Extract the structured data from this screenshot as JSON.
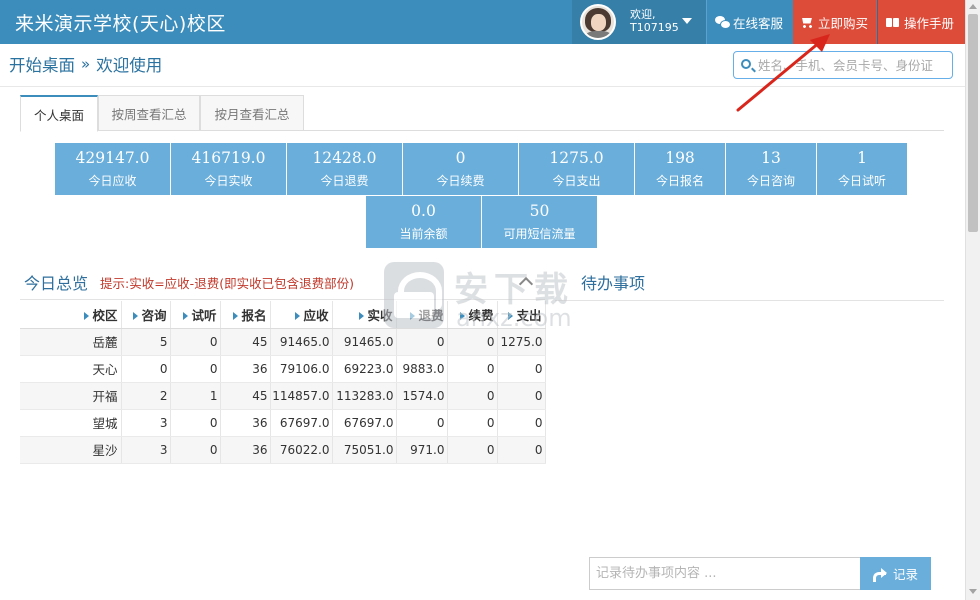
{
  "app": {
    "title": "来米演示学校(天心)校区"
  },
  "user": {
    "welcome": "欢迎,",
    "id": "T107195"
  },
  "header_buttons": {
    "service": "在线客服",
    "buy": "立即购买",
    "manual": "操作手册"
  },
  "breadcrumb": {
    "home": "开始桌面",
    "separator": "»",
    "current": "欢迎使用"
  },
  "search": {
    "placeholder": "姓名、手机、会员卡号、身份证"
  },
  "tabs": [
    {
      "label": "个人桌面",
      "active": true
    },
    {
      "label": "按周查看汇总",
      "active": false
    },
    {
      "label": "按月查看汇总",
      "active": false
    }
  ],
  "stats_row1": [
    {
      "value": "429147.0",
      "label": "今日应收"
    },
    {
      "value": "416719.0",
      "label": "今日实收"
    },
    {
      "value": "12428.0",
      "label": "今日退费"
    },
    {
      "value": "0",
      "label": "今日续费"
    },
    {
      "value": "1275.0",
      "label": "今日支出"
    },
    {
      "value": "198",
      "label": "今日报名"
    },
    {
      "value": "13",
      "label": "今日咨询"
    },
    {
      "value": "1",
      "label": "今日试听"
    }
  ],
  "stats_row2": [
    {
      "value": "0.0",
      "label": "当前余额"
    },
    {
      "value": "50",
      "label": "可用短信流量"
    }
  ],
  "summary": {
    "title": "今日总览",
    "hint": "提示:实收=应收-退费(即实收已包含退费部份)",
    "columns": [
      "校区",
      "咨询",
      "试听",
      "报名",
      "应收",
      "实收",
      "退费",
      "续费",
      "支出"
    ],
    "rows": [
      [
        "岳麓",
        "5",
        "0",
        "45",
        "91465.0",
        "91465.0",
        "0",
        "0",
        "1275.0"
      ],
      [
        "天心",
        "0",
        "0",
        "36",
        "79106.0",
        "69223.0",
        "9883.0",
        "0",
        "0"
      ],
      [
        "开福",
        "2",
        "1",
        "45",
        "114857.0",
        "113283.0",
        "1574.0",
        "0",
        "0"
      ],
      [
        "望城",
        "3",
        "0",
        "36",
        "67697.0",
        "67697.0",
        "0",
        "0",
        "0"
      ],
      [
        "星沙",
        "3",
        "0",
        "36",
        "76022.0",
        "75051.0",
        "971.0",
        "0",
        "0"
      ]
    ]
  },
  "todo": {
    "title": "待办事项",
    "placeholder": "记录待办事项内容 ...",
    "button": "记录"
  },
  "watermark": {
    "cn": "安下载",
    "en": "anxz.com"
  },
  "colors": {
    "topbar": "#3c8dbc",
    "user_box": "#367fa9",
    "buy": "#dd4b39",
    "tile": "#6aaedb",
    "hint": "#c0392b",
    "arrow": "#d9261c"
  }
}
